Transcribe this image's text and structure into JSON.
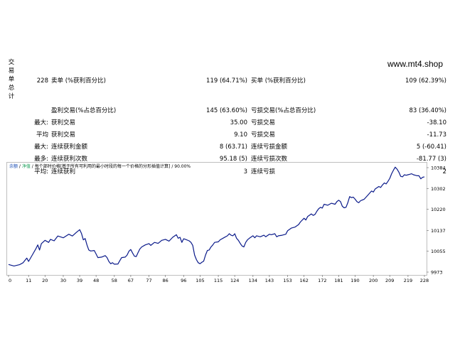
{
  "watermark": "www.mt4.shop",
  "side_label": [
    "交",
    "易",
    "单",
    "总",
    "计"
  ],
  "rows": [
    {
      "a": "228",
      "b": "卖单 (%获利百分比)",
      "c": "119 (64.71%)",
      "d": "买单 (%获利百分比)",
      "e": "109 (62.39%)"
    },
    {
      "a": "",
      "b": "盈利交易(%占总百分比)",
      "c": "145 (63.60%)",
      "d": "亏损交易(%占总百分比)",
      "e": "83 (36.40%)"
    },
    {
      "a": "最大:",
      "b": "获利交易",
      "c": "35.00",
      "d": "亏损交易",
      "e": "-38.10"
    },
    {
      "a": "平均",
      "b": "获利交易",
      "c": "9.10",
      "d": "亏损交易",
      "e": "-11.73"
    },
    {
      "a": "最大:",
      "b": "连续获利金额",
      "c": "8 (63.71)",
      "d": "连续亏损金额",
      "e": "5 (-60.41)"
    },
    {
      "a": "最多:",
      "b": "连续获利次数",
      "c": "95.18 (5)",
      "d": "连续亏损次数",
      "e": "-81.77 (3)"
    },
    {
      "a": "平均:",
      "b": "连续获利",
      "c": "3",
      "d": "连续亏损",
      "e": "2"
    }
  ],
  "chart_header": {
    "balance": "余额",
    "sep1": " / ",
    "equity": "净值",
    "sep2": " / ",
    "desc": "每个部时价格[基于所有可利用的最小时段的每一个价格的分形插值计算]",
    "sep3": " / ",
    "quality": "90.00%"
  },
  "chart_data": {
    "type": "line",
    "y_ticks": [
      10384,
      10302,
      10220,
      10137,
      10055,
      9973
    ],
    "x_ticks": [
      0,
      11,
      20,
      30,
      39,
      48,
      58,
      67,
      77,
      86,
      96,
      105,
      115,
      124,
      134,
      143,
      153,
      162,
      172,
      181,
      190,
      200,
      209,
      219,
      228
    ],
    "ylim": [
      9973,
      10384
    ],
    "xlim": [
      0,
      228
    ],
    "series": [
      {
        "color": "#0a1a8a",
        "points": [
          [
            0,
            10003
          ],
          [
            3,
            9997
          ],
          [
            6,
            10002
          ],
          [
            8,
            10010
          ],
          [
            10,
            10028
          ],
          [
            11,
            10015
          ],
          [
            13,
            10040
          ],
          [
            15,
            10065
          ],
          [
            16,
            10080
          ],
          [
            17,
            10060
          ],
          [
            18,
            10085
          ],
          [
            20,
            10098
          ],
          [
            22,
            10090
          ],
          [
            23,
            10102
          ],
          [
            25,
            10096
          ],
          [
            27,
            10115
          ],
          [
            30,
            10108
          ],
          [
            33,
            10122
          ],
          [
            35,
            10115
          ],
          [
            37,
            10128
          ],
          [
            39,
            10140
          ],
          [
            40,
            10125
          ],
          [
            41,
            10100
          ],
          [
            42,
            10105
          ],
          [
            43,
            10080
          ],
          [
            44,
            10060
          ],
          [
            45,
            10056
          ],
          [
            47,
            10058
          ],
          [
            48,
            10044
          ],
          [
            49,
            10030
          ],
          [
            51,
            10032
          ],
          [
            53,
            10038
          ],
          [
            54,
            10030
          ],
          [
            55,
            10015
          ],
          [
            56,
            10006
          ],
          [
            57,
            10010
          ],
          [
            58,
            10004
          ],
          [
            60,
            10005
          ],
          [
            61,
            10018
          ],
          [
            62,
            10030
          ],
          [
            64,
            10032
          ],
          [
            65,
            10040
          ],
          [
            66,
            10055
          ],
          [
            67,
            10062
          ],
          [
            68,
            10048
          ],
          [
            69,
            10036
          ],
          [
            70,
            10034
          ],
          [
            71,
            10050
          ],
          [
            72,
            10064
          ],
          [
            73,
            10072
          ],
          [
            75,
            10080
          ],
          [
            77,
            10085
          ],
          [
            78,
            10078
          ],
          [
            80,
            10090
          ],
          [
            82,
            10086
          ],
          [
            84,
            10098
          ],
          [
            86,
            10102
          ],
          [
            88,
            10095
          ],
          [
            90,
            10110
          ],
          [
            92,
            10120
          ],
          [
            93,
            10106
          ],
          [
            94,
            10110
          ],
          [
            95,
            10090
          ],
          [
            96,
            10104
          ],
          [
            97,
            10102
          ],
          [
            99,
            10096
          ],
          [
            100,
            10090
          ],
          [
            101,
            10078
          ],
          [
            102,
            10040
          ],
          [
            103,
            10022
          ],
          [
            104,
            10010
          ],
          [
            105,
            10006
          ],
          [
            106,
            10012
          ],
          [
            107,
            10016
          ],
          [
            108,
            10040
          ],
          [
            109,
            10058
          ],
          [
            110,
            10060
          ],
          [
            111,
            10072
          ],
          [
            112,
            10080
          ],
          [
            113,
            10090
          ],
          [
            115,
            10092
          ],
          [
            116,
            10100
          ],
          [
            118,
            10108
          ],
          [
            120,
            10116
          ],
          [
            121,
            10124
          ],
          [
            122,
            10118
          ],
          [
            123,
            10116
          ],
          [
            124,
            10124
          ],
          [
            125,
            10106
          ],
          [
            126,
            10098
          ],
          [
            127,
            10086
          ],
          [
            128,
            10076
          ],
          [
            129,
            10072
          ],
          [
            130,
            10090
          ],
          [
            131,
            10100
          ],
          [
            132,
            10106
          ],
          [
            134,
            10116
          ],
          [
            135,
            10108
          ],
          [
            136,
            10116
          ],
          [
            138,
            10112
          ],
          [
            140,
            10118
          ],
          [
            141,
            10112
          ],
          [
            143,
            10122
          ],
          [
            144,
            10120
          ],
          [
            146,
            10124
          ],
          [
            147,
            10112
          ],
          [
            148,
            10116
          ],
          [
            150,
            10118
          ],
          [
            152,
            10122
          ],
          [
            153,
            10136
          ],
          [
            155,
            10146
          ],
          [
            157,
            10150
          ],
          [
            159,
            10160
          ],
          [
            160,
            10170
          ],
          [
            162,
            10185
          ],
          [
            163,
            10178
          ],
          [
            164,
            10192
          ],
          [
            166,
            10202
          ],
          [
            167,
            10196
          ],
          [
            168,
            10200
          ],
          [
            169,
            10212
          ],
          [
            170,
            10222
          ],
          [
            171,
            10228
          ],
          [
            172,
            10225
          ],
          [
            173,
            10240
          ],
          [
            175,
            10236
          ],
          [
            177,
            10244
          ],
          [
            179,
            10240
          ],
          [
            180,
            10250
          ],
          [
            181,
            10256
          ],
          [
            182,
            10250
          ],
          [
            183,
            10232
          ],
          [
            184,
            10226
          ],
          [
            185,
            10228
          ],
          [
            186,
            10246
          ],
          [
            187,
            10270
          ],
          [
            188,
            10266
          ],
          [
            189,
            10268
          ],
          [
            190,
            10260
          ],
          [
            191,
            10250
          ],
          [
            192,
            10246
          ],
          [
            193,
            10254
          ],
          [
            195,
            10260
          ],
          [
            197,
            10276
          ],
          [
            199,
            10292
          ],
          [
            200,
            10288
          ],
          [
            201,
            10300
          ],
          [
            203,
            10310
          ],
          [
            204,
            10306
          ],
          [
            205,
            10316
          ],
          [
            206,
            10324
          ],
          [
            207,
            10320
          ],
          [
            208,
            10330
          ],
          [
            209,
            10342
          ],
          [
            210,
            10360
          ],
          [
            211,
            10374
          ],
          [
            212,
            10386
          ],
          [
            213,
            10378
          ],
          [
            214,
            10366
          ],
          [
            215,
            10350
          ],
          [
            216,
            10348
          ],
          [
            217,
            10356
          ],
          [
            218,
            10354
          ],
          [
            219,
            10356
          ],
          [
            220,
            10358
          ],
          [
            221,
            10360
          ],
          [
            222,
            10356
          ],
          [
            223,
            10354
          ],
          [
            224,
            10352
          ],
          [
            225,
            10352
          ],
          [
            226,
            10340
          ],
          [
            227,
            10346
          ],
          [
            228,
            10348
          ]
        ]
      }
    ]
  },
  "colors": {
    "chart_border": "#bfbfbf",
    "balance_line": "#0a1a8a",
    "equity_label": "#1aa05a",
    "header_blue": "#1c4fb5"
  }
}
